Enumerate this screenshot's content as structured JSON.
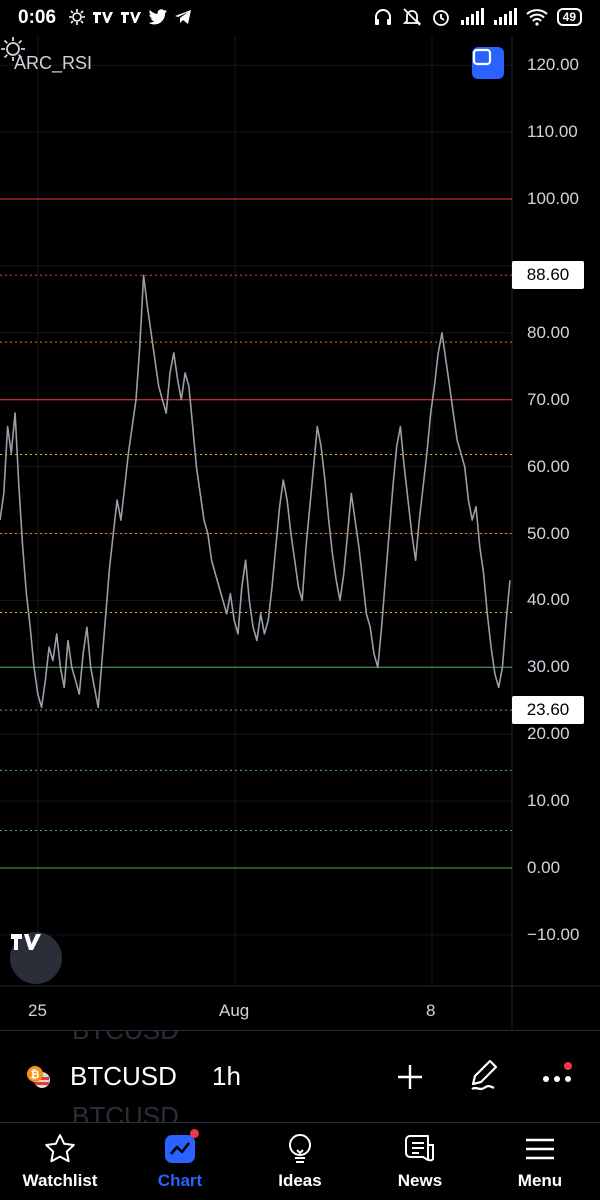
{
  "status_bar": {
    "time": "0:06",
    "battery": "49"
  },
  "indicator": {
    "name": "ARC_RSI"
  },
  "price_labels": {
    "upper": "88.60",
    "lower": "23.60"
  },
  "chart_data": {
    "type": "line",
    "title": "ARC_RSI",
    "x_tick_labels": [
      "25",
      "Aug",
      "8"
    ],
    "y_tick_labels": [
      "120.00",
      "110.00",
      "100.00",
      "80.00",
      "70.00",
      "60.00",
      "50.00",
      "40.00",
      "30.00",
      "20.00",
      "10.00",
      "0.00",
      "−10.00"
    ],
    "ylim": [
      -15,
      125
    ],
    "grid": true,
    "levels": [
      {
        "value": 100,
        "color": "#f23645",
        "style": "solid"
      },
      {
        "value": 88.6,
        "color": "#f23645",
        "style": "dotted"
      },
      {
        "value": 78.6,
        "color": "#f57c00",
        "style": "dotted"
      },
      {
        "value": 70,
        "color": "#f23645",
        "style": "solid"
      },
      {
        "value": 61.8,
        "color": "#ffa726",
        "style": "dotted"
      },
      {
        "value": 50,
        "color": "#f57c00",
        "style": "dotted"
      },
      {
        "value": 38.2,
        "color": "#ffa726",
        "style": "dotted"
      },
      {
        "value": 30,
        "color": "#4caf50",
        "style": "solid"
      },
      {
        "value": 23.6,
        "color": "#4caf50",
        "style": "dotted"
      },
      {
        "value": 14.6,
        "color": "#4caf50",
        "style": "dotted"
      },
      {
        "value": 5.6,
        "color": "#4caf50",
        "style": "dotted"
      },
      {
        "value": 0,
        "color": "#4caf50",
        "style": "solid"
      }
    ],
    "series": [
      {
        "color": "#9a9ea8",
        "values": [
          52,
          56,
          66,
          62,
          68,
          57,
          48,
          41,
          36,
          30,
          26,
          24,
          28,
          33,
          31,
          35,
          30,
          27,
          34,
          30,
          28,
          26,
          32,
          36,
          30,
          27,
          24,
          31,
          38,
          45,
          50,
          55,
          52,
          57,
          62,
          66,
          70,
          78,
          88.6,
          84,
          80,
          76,
          72,
          70,
          68,
          74,
          77,
          73,
          70,
          74,
          72,
          66,
          60,
          56,
          52,
          50,
          46,
          44,
          42,
          40,
          38,
          41,
          37,
          35,
          42,
          46,
          40,
          36,
          34,
          38,
          35,
          37,
          42,
          48,
          54,
          58,
          55,
          50,
          46,
          42,
          40,
          48,
          54,
          60,
          66,
          63,
          58,
          52,
          47,
          43,
          40,
          44,
          50,
          56,
          52,
          48,
          43,
          38,
          36,
          32,
          30,
          36,
          43,
          50,
          57,
          63,
          66,
          60,
          55,
          50,
          46,
          52,
          57,
          62,
          68,
          72,
          77,
          80,
          76,
          72,
          68,
          64,
          62,
          60,
          55,
          52,
          54,
          48,
          44,
          38,
          33,
          29,
          27,
          30,
          37,
          43
        ]
      }
    ]
  },
  "settings_icon": "sun-icon",
  "symbol_bar": {
    "symbol": "BTCUSD",
    "ghost_symbol": "BTCUSD",
    "interval": "1h",
    "coin_icon": "bitcoin-icon",
    "plus_icon": "plus-icon",
    "draw_icon": "pen-icon",
    "more_icon": "more-dots-icon"
  },
  "nav": {
    "watchlist": "Watchlist",
    "chart": "Chart",
    "ideas": "Ideas",
    "news": "News",
    "menu": "Menu"
  },
  "colors": {
    "accent": "#2962ff",
    "background": "#000000",
    "notification": "#f23645"
  }
}
